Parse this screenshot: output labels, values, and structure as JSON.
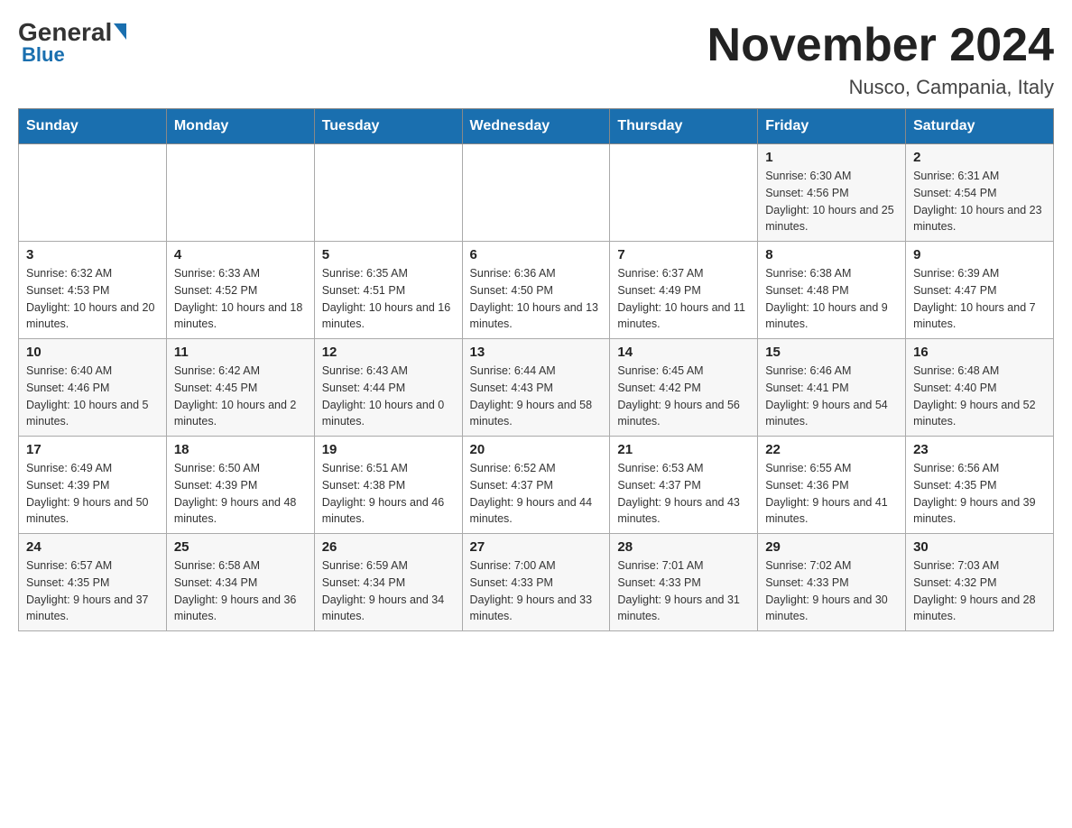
{
  "logo": {
    "general_text": "General",
    "blue_text": "Blue"
  },
  "title": "November 2024",
  "subtitle": "Nusco, Campania, Italy",
  "weekdays": [
    "Sunday",
    "Monday",
    "Tuesday",
    "Wednesday",
    "Thursday",
    "Friday",
    "Saturday"
  ],
  "weeks": [
    [
      {
        "day": "",
        "info": ""
      },
      {
        "day": "",
        "info": ""
      },
      {
        "day": "",
        "info": ""
      },
      {
        "day": "",
        "info": ""
      },
      {
        "day": "",
        "info": ""
      },
      {
        "day": "1",
        "info": "Sunrise: 6:30 AM\nSunset: 4:56 PM\nDaylight: 10 hours and 25 minutes."
      },
      {
        "day": "2",
        "info": "Sunrise: 6:31 AM\nSunset: 4:54 PM\nDaylight: 10 hours and 23 minutes."
      }
    ],
    [
      {
        "day": "3",
        "info": "Sunrise: 6:32 AM\nSunset: 4:53 PM\nDaylight: 10 hours and 20 minutes."
      },
      {
        "day": "4",
        "info": "Sunrise: 6:33 AM\nSunset: 4:52 PM\nDaylight: 10 hours and 18 minutes."
      },
      {
        "day": "5",
        "info": "Sunrise: 6:35 AM\nSunset: 4:51 PM\nDaylight: 10 hours and 16 minutes."
      },
      {
        "day": "6",
        "info": "Sunrise: 6:36 AM\nSunset: 4:50 PM\nDaylight: 10 hours and 13 minutes."
      },
      {
        "day": "7",
        "info": "Sunrise: 6:37 AM\nSunset: 4:49 PM\nDaylight: 10 hours and 11 minutes."
      },
      {
        "day": "8",
        "info": "Sunrise: 6:38 AM\nSunset: 4:48 PM\nDaylight: 10 hours and 9 minutes."
      },
      {
        "day": "9",
        "info": "Sunrise: 6:39 AM\nSunset: 4:47 PM\nDaylight: 10 hours and 7 minutes."
      }
    ],
    [
      {
        "day": "10",
        "info": "Sunrise: 6:40 AM\nSunset: 4:46 PM\nDaylight: 10 hours and 5 minutes."
      },
      {
        "day": "11",
        "info": "Sunrise: 6:42 AM\nSunset: 4:45 PM\nDaylight: 10 hours and 2 minutes."
      },
      {
        "day": "12",
        "info": "Sunrise: 6:43 AM\nSunset: 4:44 PM\nDaylight: 10 hours and 0 minutes."
      },
      {
        "day": "13",
        "info": "Sunrise: 6:44 AM\nSunset: 4:43 PM\nDaylight: 9 hours and 58 minutes."
      },
      {
        "day": "14",
        "info": "Sunrise: 6:45 AM\nSunset: 4:42 PM\nDaylight: 9 hours and 56 minutes."
      },
      {
        "day": "15",
        "info": "Sunrise: 6:46 AM\nSunset: 4:41 PM\nDaylight: 9 hours and 54 minutes."
      },
      {
        "day": "16",
        "info": "Sunrise: 6:48 AM\nSunset: 4:40 PM\nDaylight: 9 hours and 52 minutes."
      }
    ],
    [
      {
        "day": "17",
        "info": "Sunrise: 6:49 AM\nSunset: 4:39 PM\nDaylight: 9 hours and 50 minutes."
      },
      {
        "day": "18",
        "info": "Sunrise: 6:50 AM\nSunset: 4:39 PM\nDaylight: 9 hours and 48 minutes."
      },
      {
        "day": "19",
        "info": "Sunrise: 6:51 AM\nSunset: 4:38 PM\nDaylight: 9 hours and 46 minutes."
      },
      {
        "day": "20",
        "info": "Sunrise: 6:52 AM\nSunset: 4:37 PM\nDaylight: 9 hours and 44 minutes."
      },
      {
        "day": "21",
        "info": "Sunrise: 6:53 AM\nSunset: 4:37 PM\nDaylight: 9 hours and 43 minutes."
      },
      {
        "day": "22",
        "info": "Sunrise: 6:55 AM\nSunset: 4:36 PM\nDaylight: 9 hours and 41 minutes."
      },
      {
        "day": "23",
        "info": "Sunrise: 6:56 AM\nSunset: 4:35 PM\nDaylight: 9 hours and 39 minutes."
      }
    ],
    [
      {
        "day": "24",
        "info": "Sunrise: 6:57 AM\nSunset: 4:35 PM\nDaylight: 9 hours and 37 minutes."
      },
      {
        "day": "25",
        "info": "Sunrise: 6:58 AM\nSunset: 4:34 PM\nDaylight: 9 hours and 36 minutes."
      },
      {
        "day": "26",
        "info": "Sunrise: 6:59 AM\nSunset: 4:34 PM\nDaylight: 9 hours and 34 minutes."
      },
      {
        "day": "27",
        "info": "Sunrise: 7:00 AM\nSunset: 4:33 PM\nDaylight: 9 hours and 33 minutes."
      },
      {
        "day": "28",
        "info": "Sunrise: 7:01 AM\nSunset: 4:33 PM\nDaylight: 9 hours and 31 minutes."
      },
      {
        "day": "29",
        "info": "Sunrise: 7:02 AM\nSunset: 4:33 PM\nDaylight: 9 hours and 30 minutes."
      },
      {
        "day": "30",
        "info": "Sunrise: 7:03 AM\nSunset: 4:32 PM\nDaylight: 9 hours and 28 minutes."
      }
    ]
  ]
}
